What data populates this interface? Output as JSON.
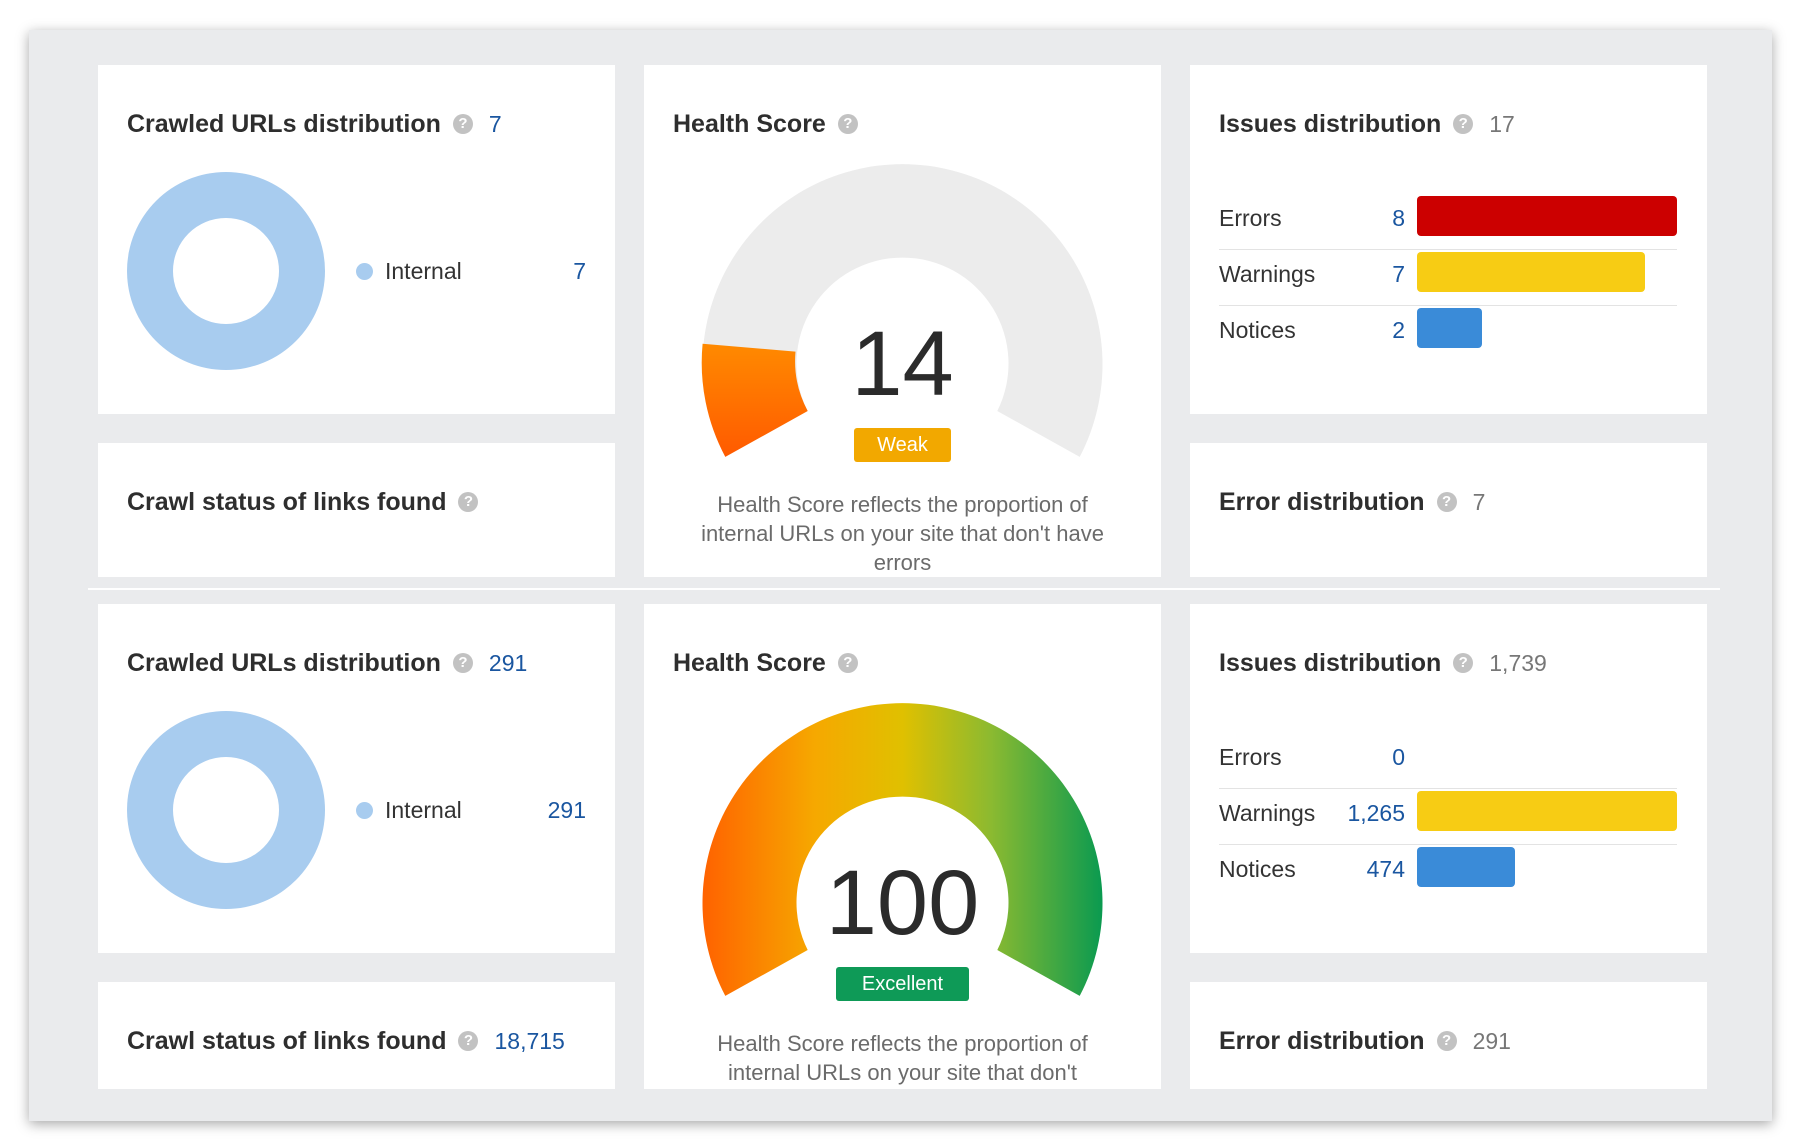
{
  "colors": {
    "internal": "#a8ccef",
    "errors": "#cc0000",
    "warnings": "#f7cc14",
    "notices": "#3a8bd8",
    "badge_weak": "#f2a800",
    "badge_excellent": "#0e9a57",
    "gauge_track": "#ececec"
  },
  "panels": [
    {
      "crawled": {
        "title": "Crawled URLs distribution",
        "count": "7",
        "legend_label": "Internal",
        "legend_value": "7"
      },
      "health": {
        "title": "Health Score",
        "score": "14",
        "score_value": 14,
        "badge": "Weak",
        "description": "Health Score reflects the proportion of internal URLs on your site that don't have errors"
      },
      "issues": {
        "title": "Issues distribution",
        "count": "17",
        "rows": [
          {
            "label": "Errors",
            "value": "8",
            "share": 1.0
          },
          {
            "label": "Warnings",
            "value": "7",
            "share": 0.875
          },
          {
            "label": "Notices",
            "value": "2",
            "share": 0.25
          }
        ]
      },
      "crawl_status": {
        "title": "Crawl status of links found",
        "count": ""
      },
      "error_dist": {
        "title": "Error distribution",
        "count": "7"
      }
    },
    {
      "crawled": {
        "title": "Crawled URLs distribution",
        "count": "291",
        "legend_label": "Internal",
        "legend_value": "291"
      },
      "health": {
        "title": "Health Score",
        "score": "100",
        "score_value": 100,
        "badge": "Excellent",
        "description": "Health Score reflects the proportion of internal URLs on your site that don't"
      },
      "issues": {
        "title": "Issues distribution",
        "count": "1,739",
        "rows": [
          {
            "label": "Errors",
            "value": "0",
            "share": 0
          },
          {
            "label": "Warnings",
            "value": "1,265",
            "share": 1.0
          },
          {
            "label": "Notices",
            "value": "474",
            "share": 0.375
          }
        ]
      },
      "crawl_status": {
        "title": "Crawl status of links found",
        "count": "18,715"
      },
      "error_dist": {
        "title": "Error distribution",
        "count": "291"
      }
    }
  ]
}
